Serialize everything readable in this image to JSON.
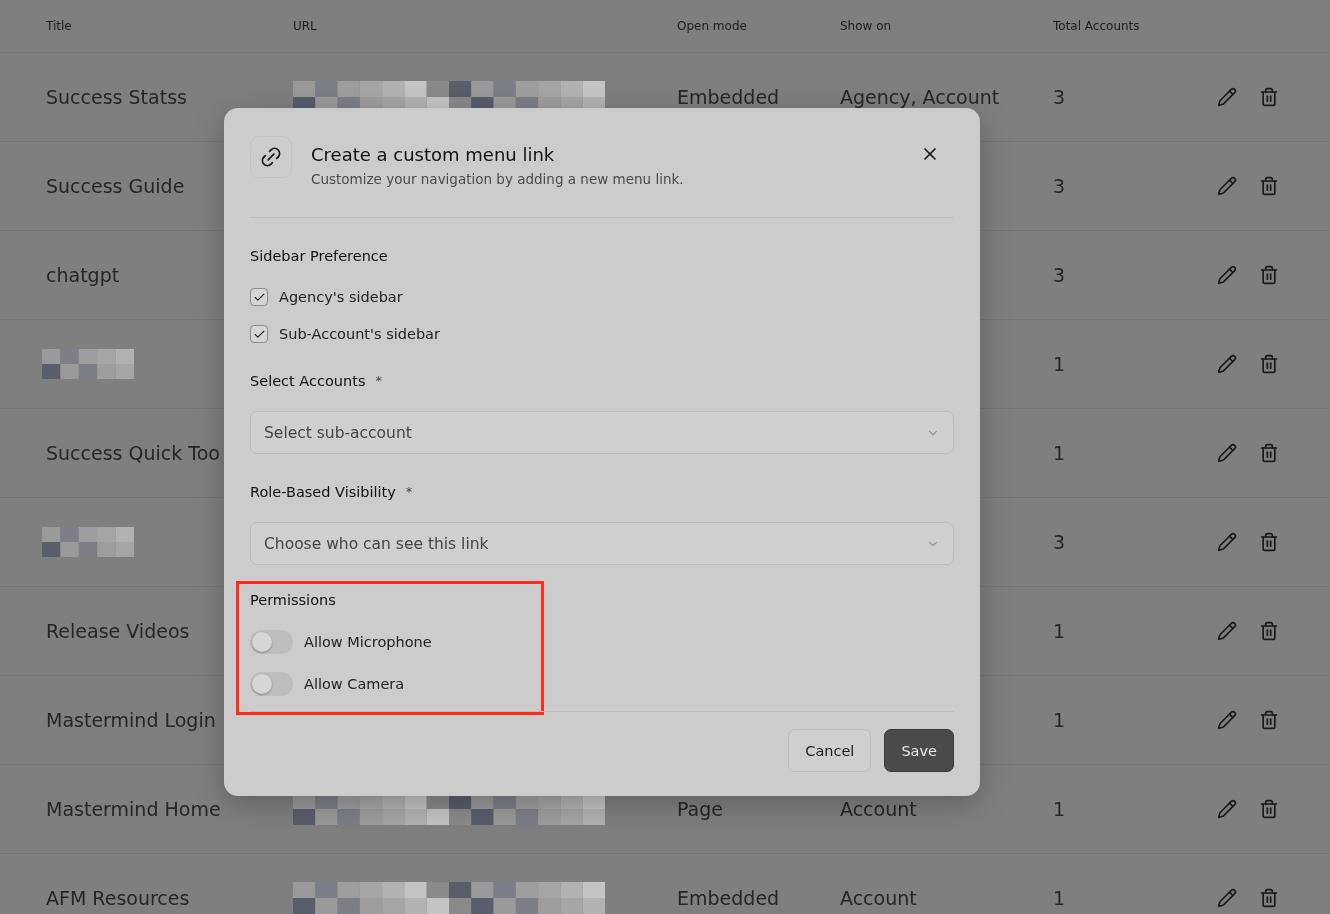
{
  "table": {
    "columns": [
      "Title",
      "URL",
      "Open mode",
      "Show on",
      "Total Accounts"
    ],
    "rows": [
      {
        "title": "Success Statss",
        "open_mode": "Embedded",
        "show_on": "Agency, Account",
        "total_accounts": "3"
      },
      {
        "title": "Success Guide",
        "total_accounts": "3"
      },
      {
        "title": "chatgpt",
        "total_accounts": "3"
      },
      {
        "total_accounts": "1"
      },
      {
        "title": "Success Quick Too",
        "total_accounts": "1"
      },
      {
        "total_accounts": "3"
      },
      {
        "title": "Release Videos",
        "total_accounts": "1"
      },
      {
        "title": "Mastermind Login",
        "total_accounts": "1"
      },
      {
        "title": "Mastermind Home",
        "open_mode": "Page",
        "show_on": "Account",
        "total_accounts": "1"
      },
      {
        "title": "AFM Resources",
        "open_mode": "Embedded",
        "show_on": "Account",
        "total_accounts": "1"
      }
    ]
  },
  "dialog": {
    "title": "Create a custom menu link",
    "subtitle": "Customize your navigation by adding a new menu link.",
    "sections": [
      {
        "kind": "checks",
        "label": "Sidebar Preference",
        "items": [
          {
            "label": "Agency's sidebar",
            "checked": true
          },
          {
            "label": "Sub-Account's sidebar",
            "checked": true
          }
        ]
      },
      {
        "kind": "select",
        "label": "Select Accounts",
        "required": "*",
        "placeholder": "Select sub-account"
      },
      {
        "kind": "select",
        "label": "Role-Based Visibility",
        "required": "*",
        "placeholder": "Choose who can see this link"
      },
      {
        "kind": "toggles",
        "label": "Permissions",
        "highlighted": true,
        "items": [
          {
            "label": "Allow Microphone",
            "on": false
          },
          {
            "label": "Allow Camera",
            "on": false
          }
        ]
      }
    ],
    "buttons": [
      {
        "label": "Cancel",
        "kind": "secondary"
      },
      {
        "label": "Save",
        "kind": "primary"
      }
    ]
  }
}
